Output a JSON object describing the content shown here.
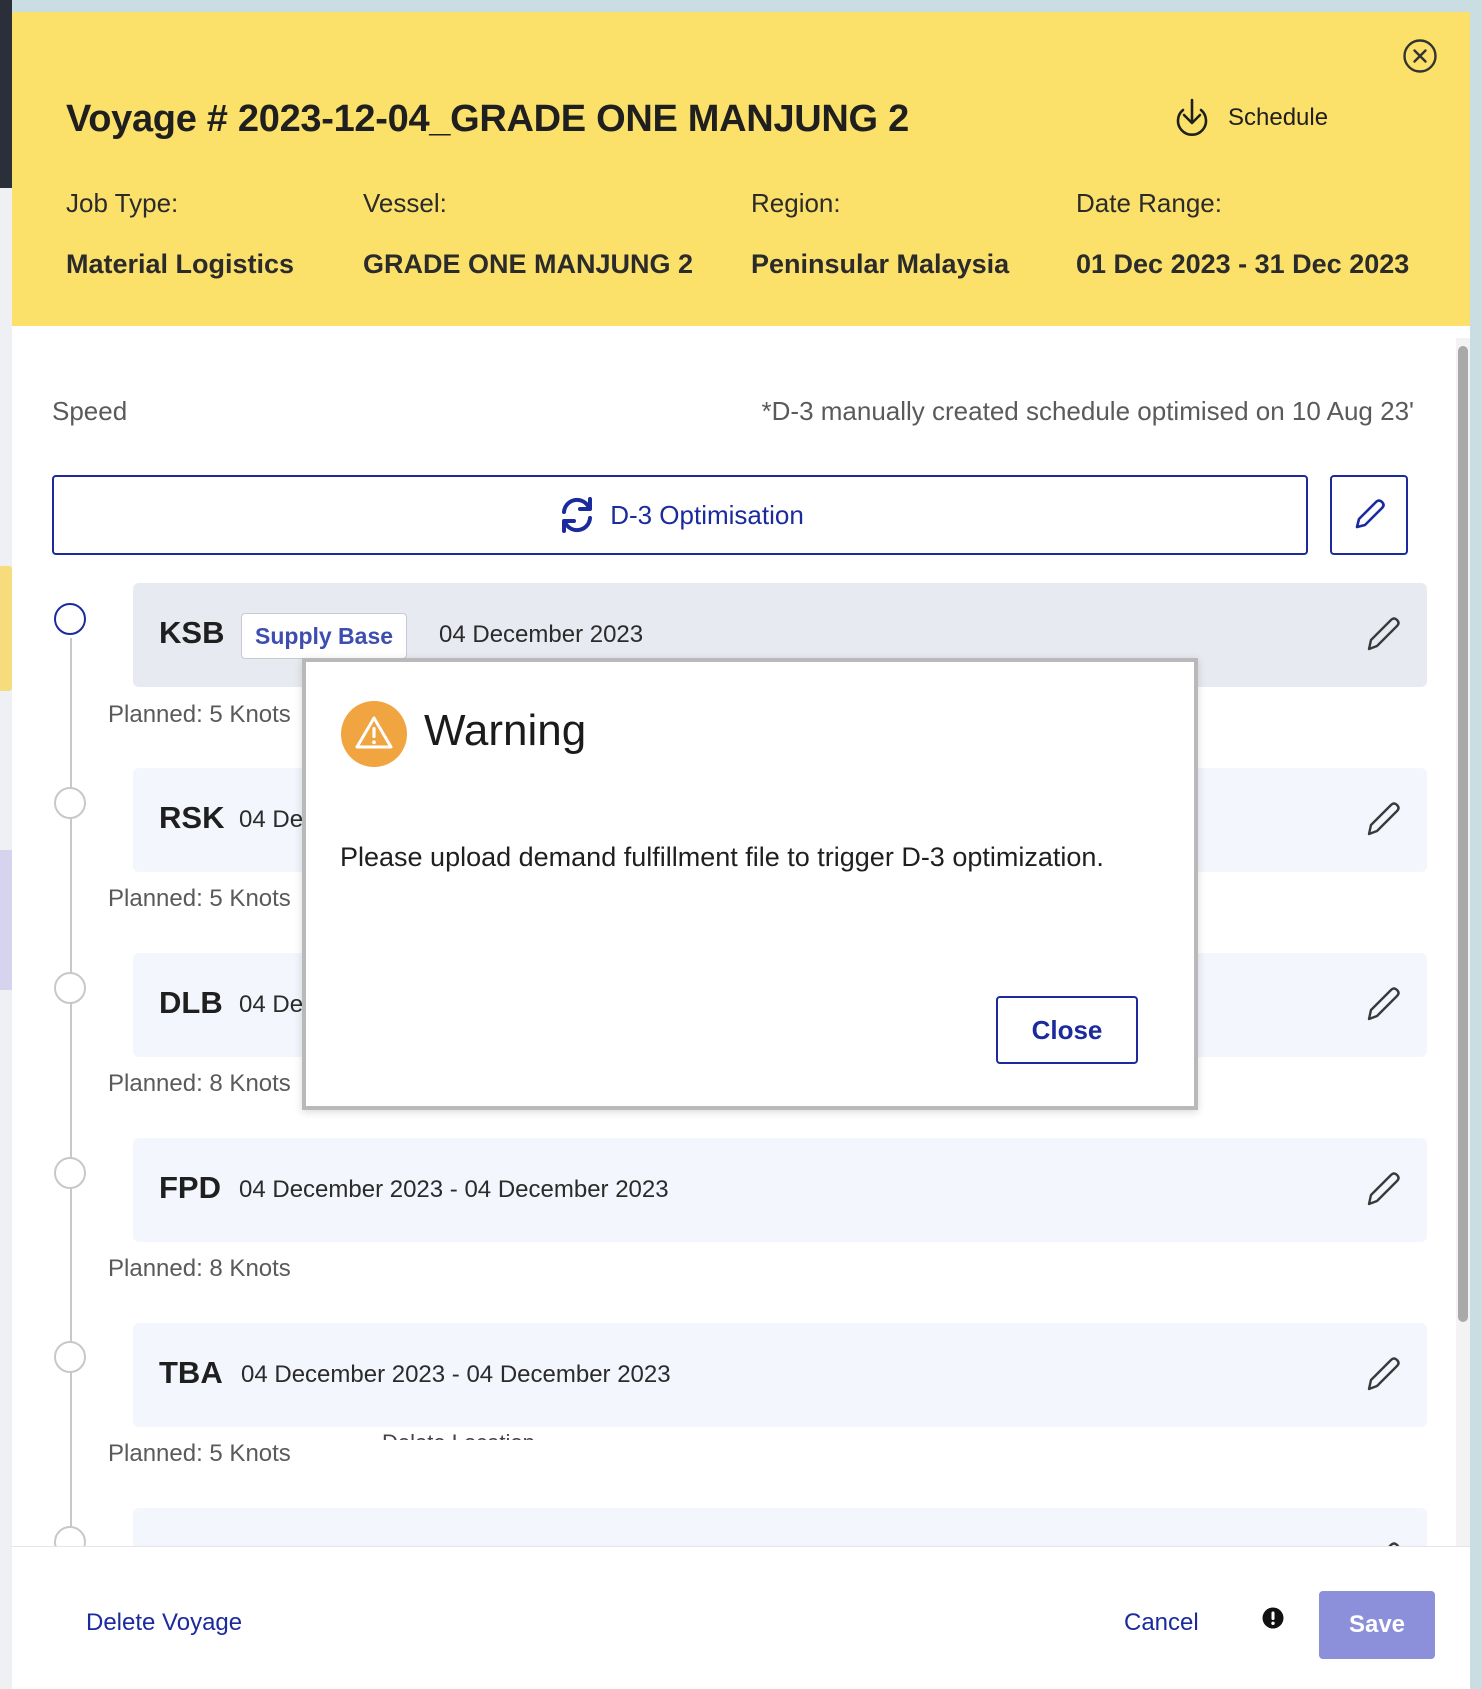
{
  "header": {
    "title": "Voyage # 2023-12-04_GRADE ONE MANJUNG 2",
    "schedule_label": "Schedule",
    "job_type_label": "Job Type:",
    "job_type_value": "Material Logistics",
    "vessel_label": "Vessel:",
    "vessel_value": "GRADE ONE MANJUNG 2",
    "region_label": "Region:",
    "region_value": "Peninsular Malaysia",
    "date_range_label": "Date Range:",
    "date_range_value": "01 Dec 2023 - 31 Dec 2023"
  },
  "speed": {
    "label": "Speed",
    "note": "*D-3 manually created schedule optimised on 10 Aug 23'"
  },
  "optimise": {
    "label": "D-3 Optimisation"
  },
  "stops": [
    {
      "code": "KSB",
      "badge": "Supply Base",
      "date": "04 December 2023"
    },
    {
      "code": "RSK",
      "date": "04 De"
    },
    {
      "code": "DLB",
      "date": "04 De"
    },
    {
      "code": "FPD",
      "date": "04 December 2023 - 04 December 2023"
    },
    {
      "code": "TBA",
      "date": "04 December 2023 - 04 December 2023"
    }
  ],
  "planned": [
    "Planned: 5 Knots",
    "Planned: 5 Knots",
    "Planned: 8 Knots",
    "Planned: 8 Knots",
    "Planned: 5 Knots"
  ],
  "hidden_text": "Delete Location",
  "dialog": {
    "title": "Warning",
    "message": "Please upload demand fulfillment file to trigger D-3 optimization.",
    "close_label": "Close"
  },
  "footer": {
    "delete_label": "Delete Voyage",
    "cancel_label": "Cancel",
    "save_label": "Save"
  },
  "colors": {
    "header_bg": "#fbe16a",
    "primary": "#1b2a9c",
    "save_disabled": "#8c8fda",
    "warning": "#f0a540"
  },
  "icons": [
    "close-circle-icon",
    "download-icon",
    "refresh-icon",
    "pencil-icon",
    "warning-triangle-icon",
    "exclamation-icon"
  ]
}
